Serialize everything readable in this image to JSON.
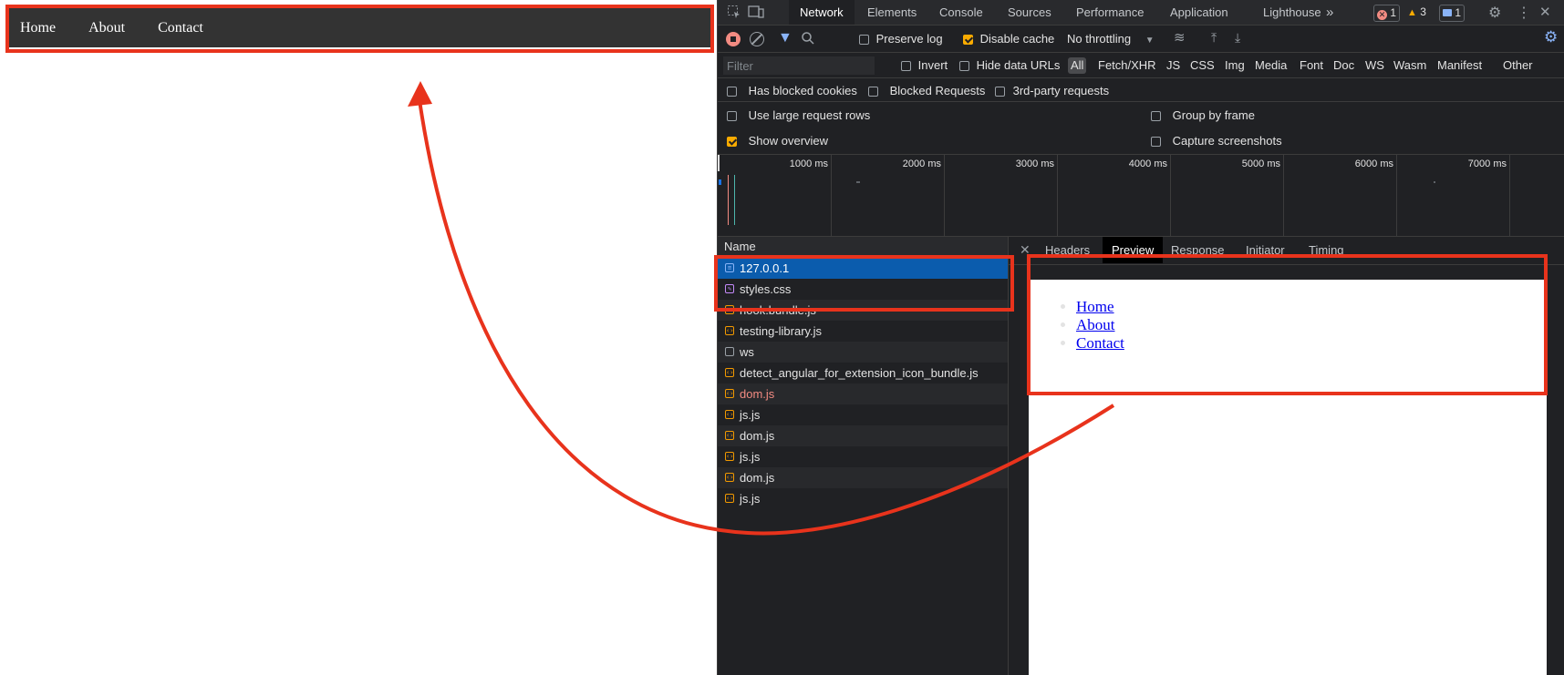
{
  "page": {
    "nav_links": [
      "Home",
      "About",
      "Contact"
    ]
  },
  "devtools": {
    "tabs": [
      "Network",
      "Elements",
      "Console",
      "Sources",
      "Performance",
      "Application",
      "Lighthouse"
    ],
    "active_tab": "Network",
    "more_tabs_icon": "double-chevron-icon",
    "counters": {
      "errors": "1",
      "warnings": "3",
      "messages": "1"
    },
    "toolbar": {
      "preserve_log": "Preserve log",
      "disable_cache": "Disable cache",
      "throttling": "No throttling"
    },
    "filter": {
      "placeholder": "Filter",
      "invert": "Invert",
      "hide_data_urls": "Hide data URLs",
      "types": [
        "All",
        "Fetch/XHR",
        "JS",
        "CSS",
        "Img",
        "Media",
        "Font",
        "Doc",
        "WS",
        "Wasm",
        "Manifest",
        "Other"
      ],
      "active_type": "All"
    },
    "blocked": {
      "has_blocked_cookies": "Has blocked cookies",
      "blocked_requests": "Blocked Requests",
      "third_party": "3rd-party requests"
    },
    "settings": {
      "use_large_rows": "Use large request rows",
      "group_by_frame": "Group by frame",
      "show_overview": "Show overview",
      "capture_screenshots": "Capture screenshots"
    },
    "overview_ticks": [
      "1000 ms",
      "2000 ms",
      "3000 ms",
      "4000 ms",
      "5000 ms",
      "6000 ms",
      "7000 ms"
    ],
    "requests": {
      "name_header": "Name",
      "rows": [
        {
          "name": "127.0.0.1",
          "type": "doc",
          "selected": true,
          "error": false
        },
        {
          "name": "styles.css",
          "type": "css",
          "selected": false,
          "error": false
        },
        {
          "name": "hook.bundle.js",
          "type": "js",
          "selected": false,
          "error": false
        },
        {
          "name": "testing-library.js",
          "type": "js",
          "selected": false,
          "error": false
        },
        {
          "name": "ws",
          "type": "ws",
          "selected": false,
          "error": false
        },
        {
          "name": "detect_angular_for_extension_icon_bundle.js",
          "type": "js",
          "selected": false,
          "error": false
        },
        {
          "name": "dom.js",
          "type": "js",
          "selected": false,
          "error": true
        },
        {
          "name": "js.js",
          "type": "js",
          "selected": false,
          "error": false
        },
        {
          "name": "dom.js",
          "type": "js",
          "selected": false,
          "error": false
        },
        {
          "name": "js.js",
          "type": "js",
          "selected": false,
          "error": false
        },
        {
          "name": "dom.js",
          "type": "js",
          "selected": false,
          "error": false
        },
        {
          "name": "js.js",
          "type": "js",
          "selected": false,
          "error": false
        }
      ]
    },
    "detail_tabs": [
      "Headers",
      "Preview",
      "Response",
      "Initiator",
      "Timing"
    ],
    "active_detail_tab": "Preview",
    "preview_links": [
      "Home",
      "About",
      "Contact"
    ]
  },
  "colors": {
    "annotation": "#e8331c",
    "selected_row": "#0b5cad",
    "accent": "#8ab4f8"
  }
}
